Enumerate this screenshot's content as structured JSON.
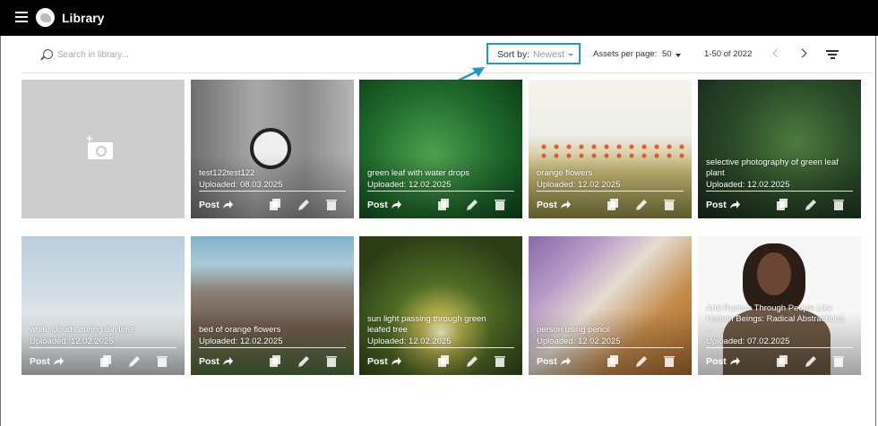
{
  "app": {
    "title": "Library",
    "menu_icon": "menu-icon",
    "logo": "logo"
  },
  "search": {
    "placeholder": "Search in library..."
  },
  "toolbar": {
    "sort_label": "Sort by:",
    "sort_value": "Newest",
    "per_page_label": "Assets per page:",
    "per_page_value": "50",
    "range": "1-50 of 2022",
    "accent": "#1d9bc6"
  },
  "cards": [
    {
      "title": "test122test122",
      "uploaded": "Uploaded: 08.03.2025",
      "post": "Post"
    },
    {
      "title": "green leaf with water drops",
      "uploaded": "Uploaded: 12.02.2025",
      "post": "Post"
    },
    {
      "title": "orange flowers",
      "uploaded": "Uploaded: 12.02.2025",
      "post": "Post"
    },
    {
      "title": "selective photography of green leaf plant",
      "uploaded": "Uploaded: 12.02.2025",
      "post": "Post"
    },
    {
      "title": "white clouds during daytime",
      "uploaded": "Uploaded: 12.02.2025",
      "post": "Post"
    },
    {
      "title": "bed of orange flowers",
      "uploaded": "Uploaded: 12.02.2025",
      "post": "Post"
    },
    {
      "title": "sun light passing through green leafed tree",
      "uploaded": "Uploaded: 12.02.2025",
      "post": "Post"
    },
    {
      "title": "person using pencil",
      "uploaded": "Uploaded: 12.02.2025",
      "post": "Post"
    },
    {
      "title": "Anti-Racism Through People Like Human Beings: Radical Abstractions, ...",
      "uploaded": "Uploaded: 07.02.2025",
      "post": "Post"
    }
  ]
}
